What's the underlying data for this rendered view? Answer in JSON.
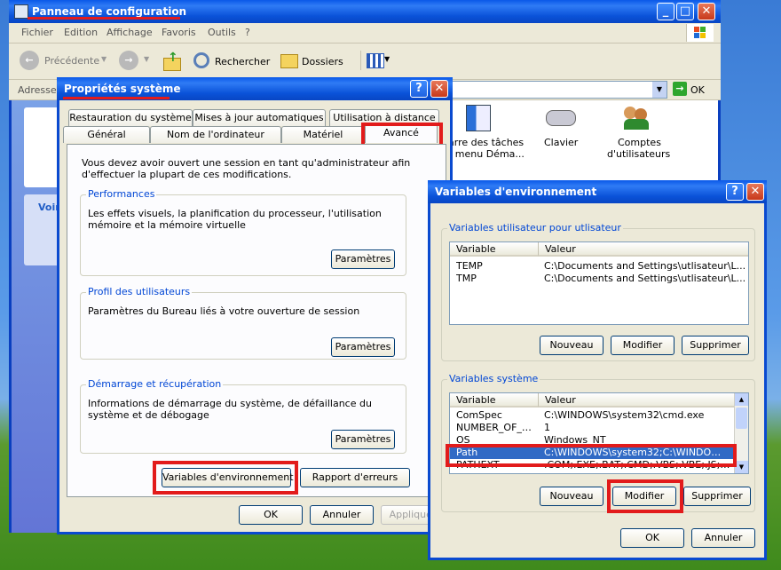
{
  "control_panel": {
    "title": "Panneau de configuration",
    "menu": [
      "Fichier",
      "Edition",
      "Affichage",
      "Favoris",
      "Outils",
      "?"
    ],
    "toolbar": {
      "back": "Précédente",
      "search": "Rechercher",
      "folders": "Dossiers"
    },
    "address_label": "Adresse",
    "go_label": "OK",
    "icons": [
      {
        "label": "Barre des tâches et menu Démarrer",
        "label_line1": "arre des tâches",
        "label_line2": "t menu Déma...",
        "icon": "taskbar-icon"
      },
      {
        "label": "Clavier",
        "label_line1": "Clavier",
        "label_line2": "",
        "icon": "keyboard-icon"
      },
      {
        "label": "Comptes d'utilisateurs",
        "label_line1": "Comptes",
        "label_line2": "d'utilisateurs",
        "icon": "users-icon"
      }
    ],
    "side_panel_title": "Voir"
  },
  "system_properties": {
    "title": "Propriétés système",
    "tabs_row1": [
      "Restauration du système",
      "Mises à jour automatiques",
      "Utilisation à distance"
    ],
    "tabs_row2": [
      "Général",
      "Nom de l'ordinateur",
      "Matériel",
      "Avancé"
    ],
    "admin_notice": "Vous devez avoir ouvert une session en tant qu'administrateur afin d'effectuer la plupart de ces modifications.",
    "groups": [
      {
        "title": "Performances",
        "text": "Les effets visuels, la planification du processeur, l'utilisation mémoire et la mémoire virtuelle",
        "button": "Paramètres"
      },
      {
        "title": "Profil des utilisateurs",
        "text": "Paramètres du Bureau liés à votre ouverture de session",
        "button": "Paramètres"
      },
      {
        "title": "Démarrage et récupération",
        "text": "Informations de démarrage du système, de défaillance du système et de débogage",
        "button": "Paramètres"
      }
    ],
    "env_button": "Variables d'environnement",
    "error_report_button": "Rapport d'erreurs",
    "ok": "OK",
    "cancel": "Annuler",
    "apply": "Appliquer"
  },
  "env_vars": {
    "title": "Variables d'environnement",
    "user_group_title": "Variables utilisateur pour utlisateur",
    "col_variable": "Variable",
    "col_value": "Valeur",
    "user_vars": [
      {
        "name": "TEMP",
        "value": "C:\\Documents and Settings\\utlisateur\\L..."
      },
      {
        "name": "TMP",
        "value": "C:\\Documents and Settings\\utlisateur\\L..."
      }
    ],
    "system_group_title": "Variables système",
    "system_vars": [
      {
        "name": "ComSpec",
        "value": "C:\\WINDOWS\\system32\\cmd.exe"
      },
      {
        "name": "NUMBER_OF_P...",
        "value": "1"
      },
      {
        "name": "OS",
        "value": "Windows_NT"
      },
      {
        "name": "Path",
        "value": "C:\\WINDOWS\\system32;C:\\WINDOWS;..."
      },
      {
        "name": "PATHEXT",
        "value": ".COM;.EXE;.BAT;.CMD;.VBS;.VBE;.JS;.JS..."
      }
    ],
    "selected_system_var": "Path",
    "new": "Nouveau",
    "edit": "Modifier",
    "delete": "Supprimer",
    "ok": "OK",
    "cancel": "Annuler"
  },
  "colors": {
    "xp_title_blue": "#0a52d8",
    "highlight_red": "#e21b1b",
    "dialog_bg": "#ece9d8",
    "selection_blue": "#316ac5"
  }
}
